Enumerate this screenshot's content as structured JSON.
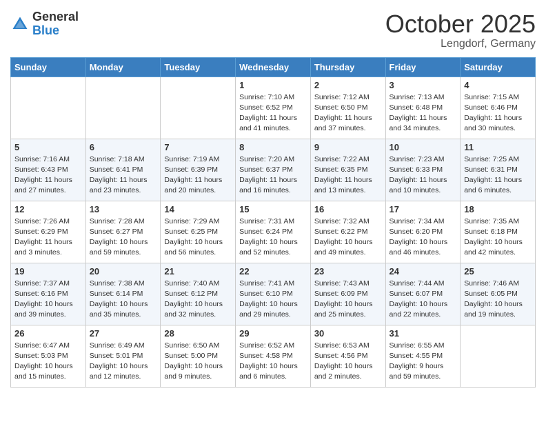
{
  "header": {
    "logo_general": "General",
    "logo_blue": "Blue",
    "month": "October 2025",
    "location": "Lengdorf, Germany"
  },
  "days": [
    "Sunday",
    "Monday",
    "Tuesday",
    "Wednesday",
    "Thursday",
    "Friday",
    "Saturday"
  ],
  "weeks": [
    [
      {
        "date": "",
        "sunrise": "",
        "sunset": "",
        "daylight": ""
      },
      {
        "date": "",
        "sunrise": "",
        "sunset": "",
        "daylight": ""
      },
      {
        "date": "",
        "sunrise": "",
        "sunset": "",
        "daylight": ""
      },
      {
        "date": "1",
        "sunrise": "Sunrise: 7:10 AM",
        "sunset": "Sunset: 6:52 PM",
        "daylight": "Daylight: 11 hours and 41 minutes."
      },
      {
        "date": "2",
        "sunrise": "Sunrise: 7:12 AM",
        "sunset": "Sunset: 6:50 PM",
        "daylight": "Daylight: 11 hours and 37 minutes."
      },
      {
        "date": "3",
        "sunrise": "Sunrise: 7:13 AM",
        "sunset": "Sunset: 6:48 PM",
        "daylight": "Daylight: 11 hours and 34 minutes."
      },
      {
        "date": "4",
        "sunrise": "Sunrise: 7:15 AM",
        "sunset": "Sunset: 6:46 PM",
        "daylight": "Daylight: 11 hours and 30 minutes."
      }
    ],
    [
      {
        "date": "5",
        "sunrise": "Sunrise: 7:16 AM",
        "sunset": "Sunset: 6:43 PM",
        "daylight": "Daylight: 11 hours and 27 minutes."
      },
      {
        "date": "6",
        "sunrise": "Sunrise: 7:18 AM",
        "sunset": "Sunset: 6:41 PM",
        "daylight": "Daylight: 11 hours and 23 minutes."
      },
      {
        "date": "7",
        "sunrise": "Sunrise: 7:19 AM",
        "sunset": "Sunset: 6:39 PM",
        "daylight": "Daylight: 11 hours and 20 minutes."
      },
      {
        "date": "8",
        "sunrise": "Sunrise: 7:20 AM",
        "sunset": "Sunset: 6:37 PM",
        "daylight": "Daylight: 11 hours and 16 minutes."
      },
      {
        "date": "9",
        "sunrise": "Sunrise: 7:22 AM",
        "sunset": "Sunset: 6:35 PM",
        "daylight": "Daylight: 11 hours and 13 minutes."
      },
      {
        "date": "10",
        "sunrise": "Sunrise: 7:23 AM",
        "sunset": "Sunset: 6:33 PM",
        "daylight": "Daylight: 11 hours and 10 minutes."
      },
      {
        "date": "11",
        "sunrise": "Sunrise: 7:25 AM",
        "sunset": "Sunset: 6:31 PM",
        "daylight": "Daylight: 11 hours and 6 minutes."
      }
    ],
    [
      {
        "date": "12",
        "sunrise": "Sunrise: 7:26 AM",
        "sunset": "Sunset: 6:29 PM",
        "daylight": "Daylight: 11 hours and 3 minutes."
      },
      {
        "date": "13",
        "sunrise": "Sunrise: 7:28 AM",
        "sunset": "Sunset: 6:27 PM",
        "daylight": "Daylight: 10 hours and 59 minutes."
      },
      {
        "date": "14",
        "sunrise": "Sunrise: 7:29 AM",
        "sunset": "Sunset: 6:25 PM",
        "daylight": "Daylight: 10 hours and 56 minutes."
      },
      {
        "date": "15",
        "sunrise": "Sunrise: 7:31 AM",
        "sunset": "Sunset: 6:24 PM",
        "daylight": "Daylight: 10 hours and 52 minutes."
      },
      {
        "date": "16",
        "sunrise": "Sunrise: 7:32 AM",
        "sunset": "Sunset: 6:22 PM",
        "daylight": "Daylight: 10 hours and 49 minutes."
      },
      {
        "date": "17",
        "sunrise": "Sunrise: 7:34 AM",
        "sunset": "Sunset: 6:20 PM",
        "daylight": "Daylight: 10 hours and 46 minutes."
      },
      {
        "date": "18",
        "sunrise": "Sunrise: 7:35 AM",
        "sunset": "Sunset: 6:18 PM",
        "daylight": "Daylight: 10 hours and 42 minutes."
      }
    ],
    [
      {
        "date": "19",
        "sunrise": "Sunrise: 7:37 AM",
        "sunset": "Sunset: 6:16 PM",
        "daylight": "Daylight: 10 hours and 39 minutes."
      },
      {
        "date": "20",
        "sunrise": "Sunrise: 7:38 AM",
        "sunset": "Sunset: 6:14 PM",
        "daylight": "Daylight: 10 hours and 35 minutes."
      },
      {
        "date": "21",
        "sunrise": "Sunrise: 7:40 AM",
        "sunset": "Sunset: 6:12 PM",
        "daylight": "Daylight: 10 hours and 32 minutes."
      },
      {
        "date": "22",
        "sunrise": "Sunrise: 7:41 AM",
        "sunset": "Sunset: 6:10 PM",
        "daylight": "Daylight: 10 hours and 29 minutes."
      },
      {
        "date": "23",
        "sunrise": "Sunrise: 7:43 AM",
        "sunset": "Sunset: 6:09 PM",
        "daylight": "Daylight: 10 hours and 25 minutes."
      },
      {
        "date": "24",
        "sunrise": "Sunrise: 7:44 AM",
        "sunset": "Sunset: 6:07 PM",
        "daylight": "Daylight: 10 hours and 22 minutes."
      },
      {
        "date": "25",
        "sunrise": "Sunrise: 7:46 AM",
        "sunset": "Sunset: 6:05 PM",
        "daylight": "Daylight: 10 hours and 19 minutes."
      }
    ],
    [
      {
        "date": "26",
        "sunrise": "Sunrise: 6:47 AM",
        "sunset": "Sunset: 5:03 PM",
        "daylight": "Daylight: 10 hours and 15 minutes."
      },
      {
        "date": "27",
        "sunrise": "Sunrise: 6:49 AM",
        "sunset": "Sunset: 5:01 PM",
        "daylight": "Daylight: 10 hours and 12 minutes."
      },
      {
        "date": "28",
        "sunrise": "Sunrise: 6:50 AM",
        "sunset": "Sunset: 5:00 PM",
        "daylight": "Daylight: 10 hours and 9 minutes."
      },
      {
        "date": "29",
        "sunrise": "Sunrise: 6:52 AM",
        "sunset": "Sunset: 4:58 PM",
        "daylight": "Daylight: 10 hours and 6 minutes."
      },
      {
        "date": "30",
        "sunrise": "Sunrise: 6:53 AM",
        "sunset": "Sunset: 4:56 PM",
        "daylight": "Daylight: 10 hours and 2 minutes."
      },
      {
        "date": "31",
        "sunrise": "Sunrise: 6:55 AM",
        "sunset": "Sunset: 4:55 PM",
        "daylight": "Daylight: 9 hours and 59 minutes."
      },
      {
        "date": "",
        "sunrise": "",
        "sunset": "",
        "daylight": ""
      }
    ]
  ]
}
